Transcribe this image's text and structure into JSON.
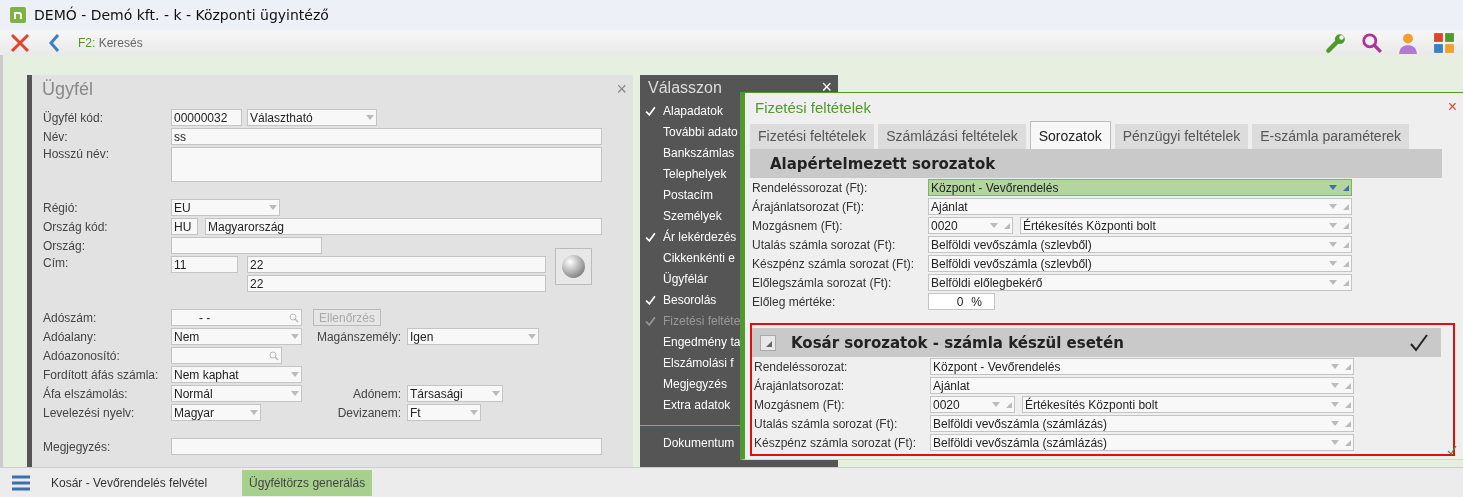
{
  "window": {
    "title": "DEMÓ - Demó kft. - k - Központi ügyintéző"
  },
  "toolbar": {
    "search_key": "F2:",
    "search_label": "Keresés"
  },
  "customer": {
    "title": "Ügyfél",
    "close": "×",
    "code_label": "Ügyfél kód:",
    "code": "00000032",
    "code_type": "Választható",
    "name_label": "Név:",
    "name": "ss",
    "long_name_label": "Hosszú név:",
    "region_label": "Régió:",
    "region": "EU",
    "country_code_label": "Ország kód:",
    "country_code": "HU",
    "country_name": "Magyarország",
    "country_label": "Ország:",
    "address_label": "Cím:",
    "zip": "11",
    "city": "22",
    "street": "22",
    "tax_number_label": "Adószám:",
    "tax_number": "- -",
    "check_button": "Ellenőrzés",
    "taxable_label": "Adóalany:",
    "taxable": "Nem",
    "private_label": "Magánszemély:",
    "private": "Igen",
    "tax_id_label": "Adóazonosító:",
    "reverse_vat_label": "Fordított áfás számla:",
    "reverse_vat": "Nem kaphat",
    "vat_label": "Áfa elszámolás:",
    "vat": "Normál",
    "tax_kind_label": "Adónem:",
    "tax_kind": "Társasági",
    "language_label": "Levelezési nyelv:",
    "language": "Magyar",
    "currency_label": "Devizanem:",
    "currency": "Ft",
    "note_label": "Megjegyzés:"
  },
  "menu": {
    "title": "Válasszon",
    "close": "×",
    "items": [
      {
        "label": "Alapadatok",
        "checked": true,
        "selected": false
      },
      {
        "label": "További adato",
        "checked": false,
        "selected": false
      },
      {
        "label": "Bankszámlas",
        "checked": false,
        "selected": false
      },
      {
        "label": "Telephelyek",
        "checked": false,
        "selected": false
      },
      {
        "label": "Postacím",
        "checked": false,
        "selected": false
      },
      {
        "label": "Személyek",
        "checked": false,
        "selected": false
      },
      {
        "label": "Ár lekérdezés",
        "checked": true,
        "selected": false
      },
      {
        "label": "Cikkenkénti e",
        "checked": false,
        "selected": false
      },
      {
        "label": "Ügyfélár",
        "checked": false,
        "selected": false
      },
      {
        "label": "Besorolás",
        "checked": true,
        "selected": false
      },
      {
        "label": "Fizetési feltéte",
        "checked": true,
        "selected": true
      },
      {
        "label": "Engedmény ta",
        "checked": false,
        "selected": false
      },
      {
        "label": "Elszámolási f",
        "checked": false,
        "selected": false
      },
      {
        "label": "Megjegyzés",
        "checked": false,
        "selected": false
      },
      {
        "label": "Extra adatok",
        "checked": false,
        "selected": false
      }
    ],
    "bottom_items": [
      {
        "label": "Dokumentum"
      }
    ]
  },
  "dialog": {
    "title": "Fizetési feltételek",
    "close": "×",
    "tabs": [
      {
        "label": "Fizetési feltételek",
        "selected": false
      },
      {
        "label": "Számlázási feltételek",
        "selected": false
      },
      {
        "label": "Sorozatok",
        "selected": true
      },
      {
        "label": "Pénzügyi feltételek",
        "selected": false
      },
      {
        "label": "E-számla paraméterek",
        "selected": false
      }
    ],
    "sections": [
      {
        "title": "Alapértelmezett sorozatok",
        "collapsible": false,
        "done": false,
        "outlined": false,
        "rows": [
          {
            "kind": "select",
            "label": "Rendeléssorozat (Ft):",
            "value": "Központ - Vevőrendelés",
            "highlighted": true
          },
          {
            "kind": "select",
            "label": "Árajánlatsorozat (Ft):",
            "value": "Ajánlat",
            "highlighted": false
          },
          {
            "kind": "pair",
            "label": "Mozgásnem (Ft):",
            "code": "0020",
            "value": "Értékesítés Központi bolt",
            "highlighted": false
          },
          {
            "kind": "select",
            "label": "Utalás számla sorozat (Ft):",
            "value": "Belföldi vevőszámla (szlevből)",
            "highlighted": false
          },
          {
            "kind": "select",
            "label": "Készpénz számla sorozat (Ft):",
            "value": "Belföldi vevőszámla (szlevből)",
            "highlighted": false
          },
          {
            "kind": "select",
            "label": "Előlegszámla sorozat (Ft):",
            "value": "Belföldi előlegbekérő",
            "highlighted": false
          },
          {
            "kind": "percent",
            "label": "Előleg mértéke:",
            "value": "0",
            "unit": "%",
            "highlighted": false
          }
        ]
      },
      {
        "title": "Kosár sorozatok - számla készül esetén",
        "collapsible": true,
        "done": true,
        "outlined": true,
        "rows": [
          {
            "kind": "select",
            "label": "Rendeléssorozat:",
            "value": "Központ - Vevőrendelés",
            "highlighted": false
          },
          {
            "kind": "select",
            "label": "Árajánlatsorozat:",
            "value": "Ajánlat",
            "highlighted": false
          },
          {
            "kind": "pair",
            "label": "Mozgásnem (Ft):",
            "code": "0020",
            "value": "Értékesítés Központi bolt",
            "highlighted": false
          },
          {
            "kind": "select",
            "label": "Utalás számla sorozat (Ft):",
            "value": "Belföldi vevőszámla (számlázás)",
            "highlighted": false
          },
          {
            "kind": "select",
            "label": "Készpénz számla sorozat (Ft):",
            "value": "Belföldi vevőszámla (számlázás)",
            "highlighted": false
          }
        ]
      }
    ]
  },
  "taskbar": {
    "items": [
      {
        "label": "Kosár - Vevőrendelés felvétel",
        "selected": false
      },
      {
        "label": "Ügyféltörzs generálás",
        "selected": true
      }
    ]
  }
}
